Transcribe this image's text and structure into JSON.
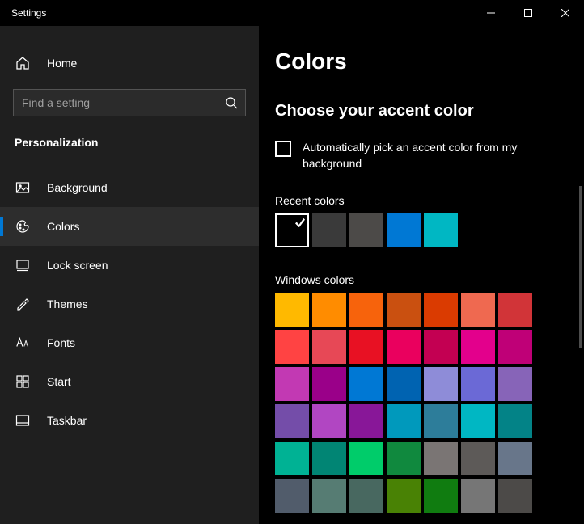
{
  "title": "Settings",
  "home_label": "Home",
  "search": {
    "placeholder": "Find a setting"
  },
  "section": "Personalization",
  "nav": [
    {
      "id": "background",
      "label": "Background"
    },
    {
      "id": "colors",
      "label": "Colors"
    },
    {
      "id": "lockscreen",
      "label": "Lock screen"
    },
    {
      "id": "themes",
      "label": "Themes"
    },
    {
      "id": "fonts",
      "label": "Fonts"
    },
    {
      "id": "start",
      "label": "Start"
    },
    {
      "id": "taskbar",
      "label": "Taskbar"
    }
  ],
  "nav_active": "colors",
  "page": {
    "title": "Colors",
    "section_heading": "Choose your accent color",
    "auto_checkbox_label": "Automatically pick an accent color from my background",
    "auto_checked": false,
    "recent_label": "Recent colors",
    "recent_colors": [
      "#000000",
      "#3a3a3a",
      "#4c4a48",
      "#0078d4",
      "#00b7c3"
    ],
    "recent_selected_index": 0,
    "windows_label": "Windows colors",
    "windows_colors": [
      "#ffb900",
      "#ff8c00",
      "#f7630c",
      "#ca5010",
      "#da3b01",
      "#ef6950",
      "#d13438",
      "#ff4343",
      "#e74856",
      "#e81123",
      "#ea005e",
      "#c30052",
      "#e3008c",
      "#bf0077",
      "#c239b3",
      "#9a0089",
      "#0078d4",
      "#0063b1",
      "#8e8cd8",
      "#6b69d6",
      "#8764b8",
      "#744da9",
      "#b146c2",
      "#881798",
      "#0099bc",
      "#2d7d9a",
      "#00b7c3",
      "#038387",
      "#00b294",
      "#018574",
      "#00cc6a",
      "#10893e",
      "#7a7574",
      "#5d5a58",
      "#68768a",
      "#515c6b",
      "#567c73",
      "#486860",
      "#498205",
      "#107c10",
      "#767676",
      "#4c4a48"
    ]
  }
}
